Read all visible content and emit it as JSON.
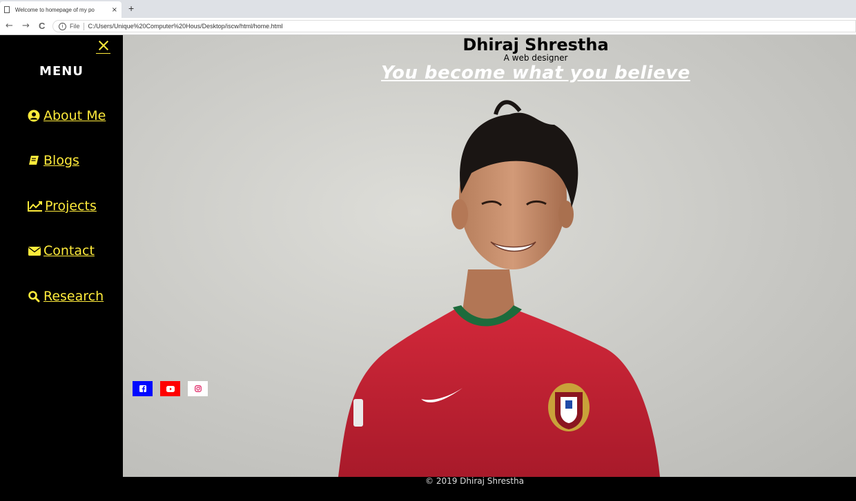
{
  "browser": {
    "tab_title": "Welcome to homepage of my po",
    "tab_close": "×",
    "new_tab": "+",
    "back": "←",
    "forward": "→",
    "reload": "C",
    "file_label": "File",
    "url": "C:/Users/Unique%20Computer%20Hous/Desktop/iscw/html/home.html"
  },
  "sidebar": {
    "title": "MENU",
    "items": [
      {
        "label": "About Me",
        "icon": "user-circle-icon"
      },
      {
        "label": "Blogs",
        "icon": "book-icon"
      },
      {
        "label": "Projects",
        "icon": "line-chart-icon"
      },
      {
        "label": "Contact",
        "icon": "envelope-icon"
      },
      {
        "label": "Research",
        "icon": "search-icon"
      }
    ]
  },
  "header": {
    "name": "Dhiraj Shrestha",
    "subtitle": "A web designer",
    "quote": "You become what you believe"
  },
  "social": [
    {
      "name": "facebook",
      "color": "#0008ff"
    },
    {
      "name": "youtube",
      "color": "#ff0000"
    },
    {
      "name": "instagram",
      "color": "#ffffff"
    }
  ],
  "footer": {
    "copyright": "© 2019 Dhiraj Shrestha"
  },
  "colors": {
    "accent": "#ffeb3b",
    "sidebar_bg": "#000000",
    "jersey": "#c4202b"
  }
}
